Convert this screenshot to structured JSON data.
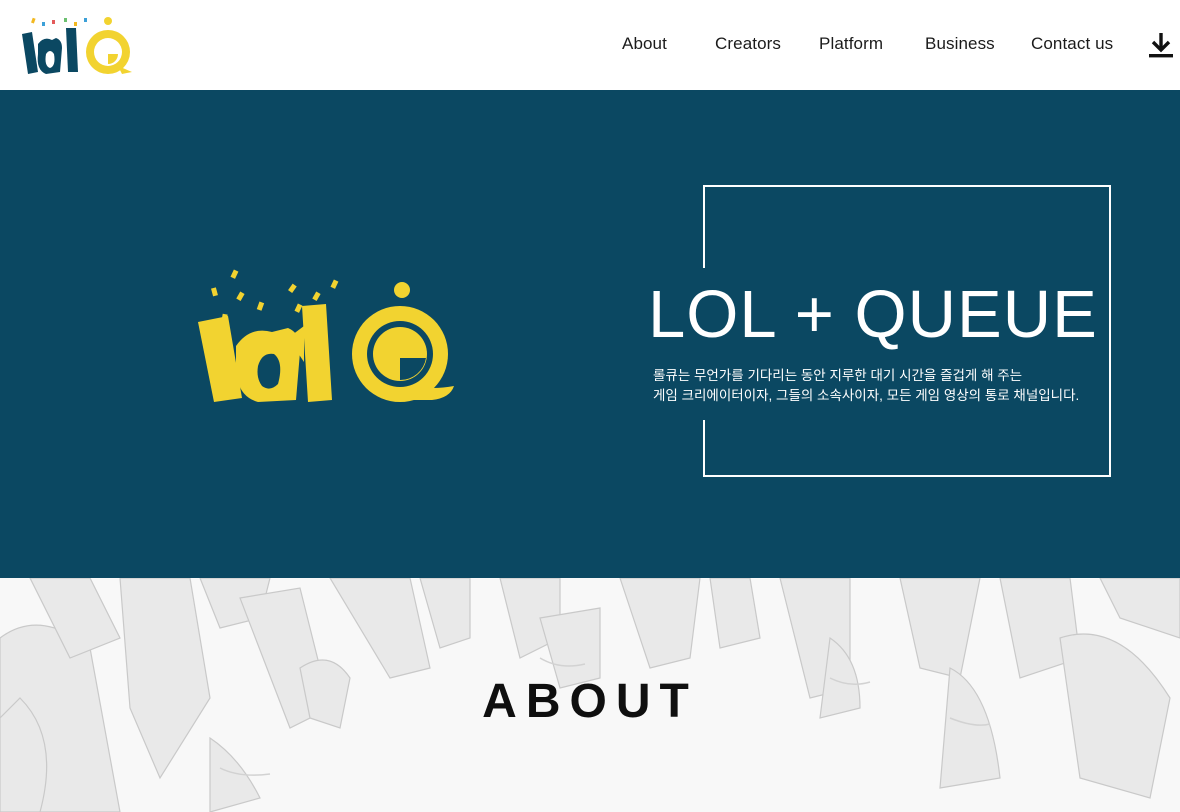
{
  "header": {
    "logo_name": "lolq-logo",
    "nav": [
      {
        "label": "About"
      },
      {
        "label": "Creators"
      },
      {
        "label": "Platform"
      },
      {
        "label": "Business"
      },
      {
        "label": "Contact us"
      }
    ],
    "download_icon": "download-icon"
  },
  "hero": {
    "title": "LOL + QUEUE",
    "description_lines": [
      "롤큐는 무언가를 기다리는 동안 지루한 대기 시간을 즐겁게 해 주는",
      "게임 크리에이터이자, 그들의 소속사이자, 모든 게임 영상의 통로 채널입니다."
    ],
    "colors": {
      "background": "#0b4862",
      "logo": "#f2d330",
      "text": "#ffffff"
    }
  },
  "about": {
    "title": "ABOUT"
  }
}
